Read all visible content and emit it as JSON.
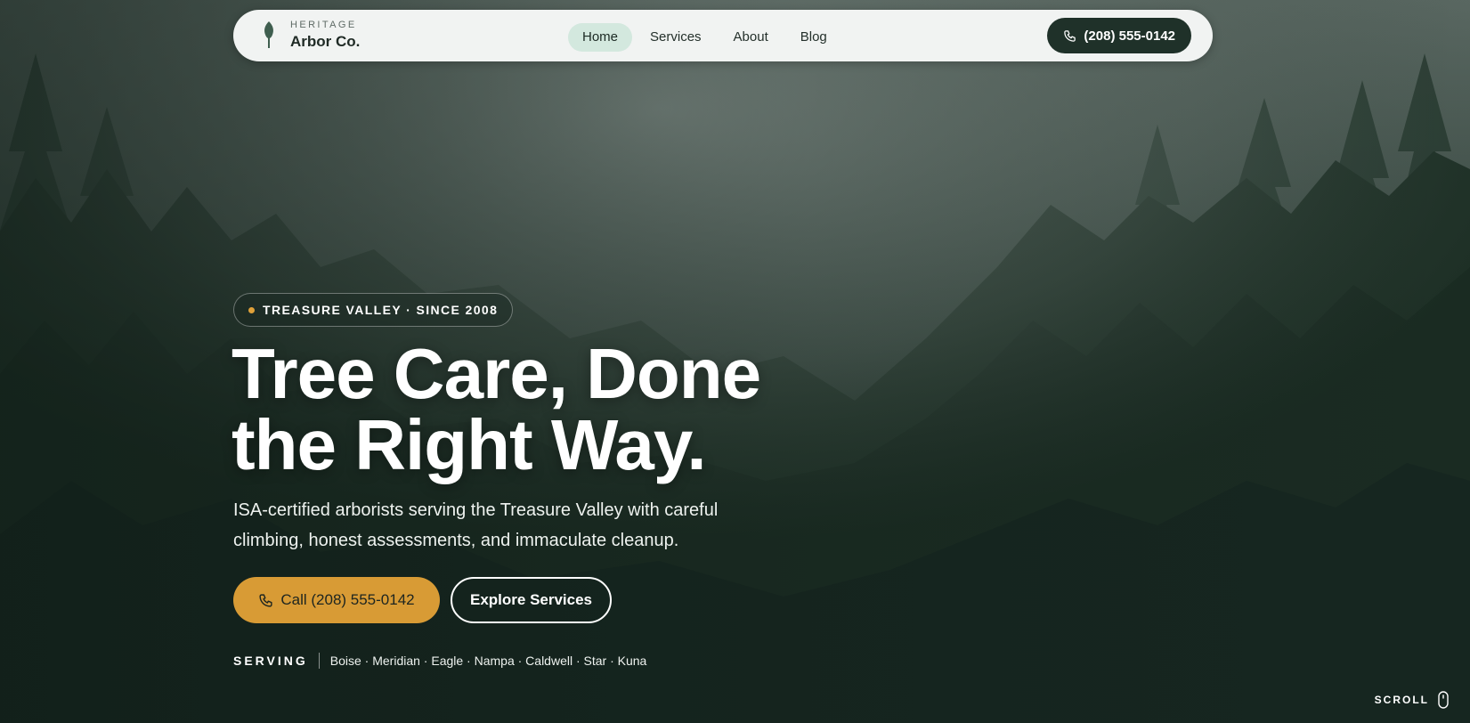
{
  "brand": {
    "kicker": "HERITAGE",
    "name": "Arbor Co.",
    "logo_icon": "tree-icon"
  },
  "nav": {
    "links": [
      {
        "label": "Home",
        "active": true
      },
      {
        "label": "Services",
        "active": false
      },
      {
        "label": "About",
        "active": false
      },
      {
        "label": "Blog",
        "active": false
      }
    ],
    "phone_label": "(208) 555-0142",
    "phone_icon": "phone-icon"
  },
  "hero": {
    "badge": "TREASURE VALLEY · SINCE 2008",
    "headline_line1": "Tree Care, Done",
    "headline_line2": "the Right Way.",
    "subcopy": "ISA-certified arborists serving the Treasure Valley with careful climbing, honest assessments, and immaculate cleanup.",
    "cta_primary": "Call (208) 555-0142",
    "cta_secondary": "Explore Services",
    "serving_label": "SERVING",
    "serving_cities": "Boise · Meridian · Eagle · Nampa · Caldwell · Star · Kuna",
    "scroll_label": "SCROLL"
  },
  "colors": {
    "accent": "#d89b35",
    "dark_green": "#1f3129",
    "active_pill": "#d3e8de",
    "badge_dot": "#e0a13a"
  }
}
